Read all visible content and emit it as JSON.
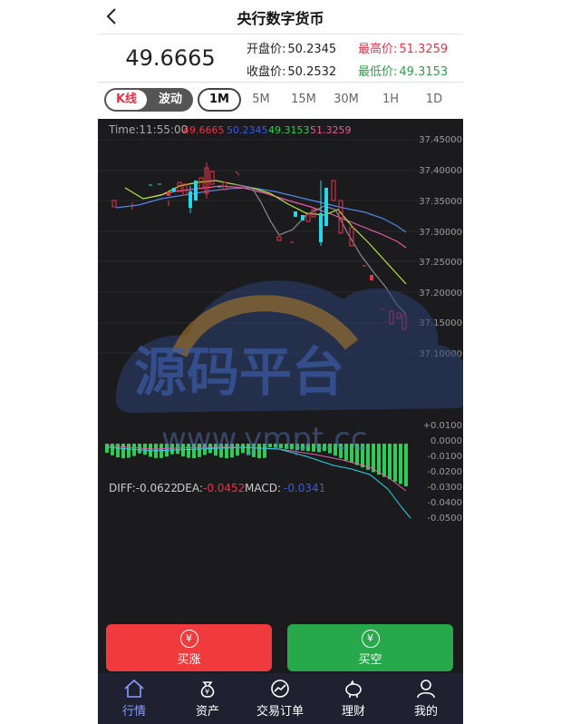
{
  "header": {
    "title": "央行数字货币"
  },
  "price": {
    "last": "49.6665",
    "open_label": "开盘价:",
    "open": "50.2345",
    "high_label": "最高价:",
    "high": "51.3259",
    "close_label": "收盘价:",
    "close": "50.2532",
    "low_label": "最低价:",
    "low": "49.3153"
  },
  "tabs": {
    "kline": "K线",
    "wave": "波动",
    "timeframes": [
      "1M",
      "5M",
      "15M",
      "30M",
      "1H",
      "1D"
    ],
    "active": "1M"
  },
  "chart_info": {
    "time": "Time:11:55:00",
    "v1": "49.6665",
    "v2": "50.2345",
    "v3": "49.3153",
    "v4": "51.3259"
  },
  "macd_info": {
    "diff": "DIFF:-0.0622",
    "dea_label": "DEA:",
    "dea": "-0.0452",
    "macd_label": "MACD:",
    "macd": "-0.0341"
  },
  "colors": {
    "up": "#e8334a",
    "down": "#25d7e8",
    "green": "#2ecc55",
    "bg": "#1b1b1d"
  },
  "chart_data": {
    "type": "table",
    "price_axis": [
      "37.45000",
      "37.40000",
      "37.35000",
      "37.30000",
      "37.25000",
      "37.20000",
      "37.15000",
      "37.10000"
    ],
    "macd_axis": [
      "+0.0100",
      "0.0000",
      "-0.0100",
      "-0.0200",
      "-0.0300",
      "-0.0400",
      "-0.0500"
    ]
  },
  "watermark": {
    "text": "源码平台",
    "url": "www.ympt.cc"
  },
  "actions": {
    "buy": "买涨",
    "sell": "买空",
    "currency_icon": "¥"
  },
  "nav": [
    "行情",
    "资产",
    "交易订单",
    "理财",
    "我的"
  ]
}
